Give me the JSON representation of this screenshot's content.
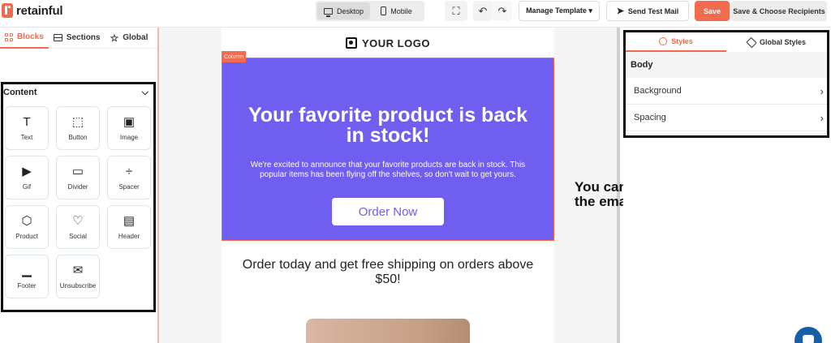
{
  "brand": {
    "name": "retainful",
    "accent": "#f26b4f"
  },
  "topbar": {
    "device": {
      "desktop": "Desktop",
      "mobile": "Mobile",
      "selected": "Desktop"
    },
    "manage_template": "Manage Template ▾",
    "send_test": "Send Test Mail",
    "save": "Save",
    "save_choose": "Save & Choose Recipients"
  },
  "left_panel": {
    "tabs": [
      {
        "label": "Blocks",
        "active": true
      },
      {
        "label": "Sections",
        "active": false
      },
      {
        "label": "Global",
        "active": false
      }
    ],
    "content_heading": "Content",
    "blocks": [
      {
        "label": "Text",
        "icon": "text-icon"
      },
      {
        "label": "Button",
        "icon": "button-icon"
      },
      {
        "label": "Image",
        "icon": "image-icon"
      },
      {
        "label": "Gif",
        "icon": "gif-icon"
      },
      {
        "label": "Divider",
        "icon": "divider-icon"
      },
      {
        "label": "Spacer",
        "icon": "spacer-icon"
      },
      {
        "label": "Product",
        "icon": "product-icon"
      },
      {
        "label": "Social",
        "icon": "heart-icon"
      },
      {
        "label": "Header",
        "icon": "header-icon"
      },
      {
        "label": "Footer",
        "icon": "footer-icon"
      },
      {
        "label": "Unsubscribe",
        "icon": "unsubscribe-icon"
      }
    ]
  },
  "email": {
    "logo_text": "YOUR LOGO",
    "column_tag": "Column",
    "hero_title": "Your favorite product is back in stock!",
    "hero_text": "We're excited to announce that your favorite products are back in stock. This popular items has been flying off the shelves, so don't wait to get yours.",
    "hero_button": "Order Now",
    "hero_bg": "#6f5ef0",
    "shipping_text": "Order today and get free shipping on orders above $50!"
  },
  "annotation": "You can drag and drop elements to the email template",
  "right_panel": {
    "tabs": [
      {
        "label": "Styles",
        "active": true
      },
      {
        "label": "Global Styles",
        "active": false
      }
    ],
    "section": "Body",
    "rows": [
      "Background",
      "Spacing"
    ]
  }
}
